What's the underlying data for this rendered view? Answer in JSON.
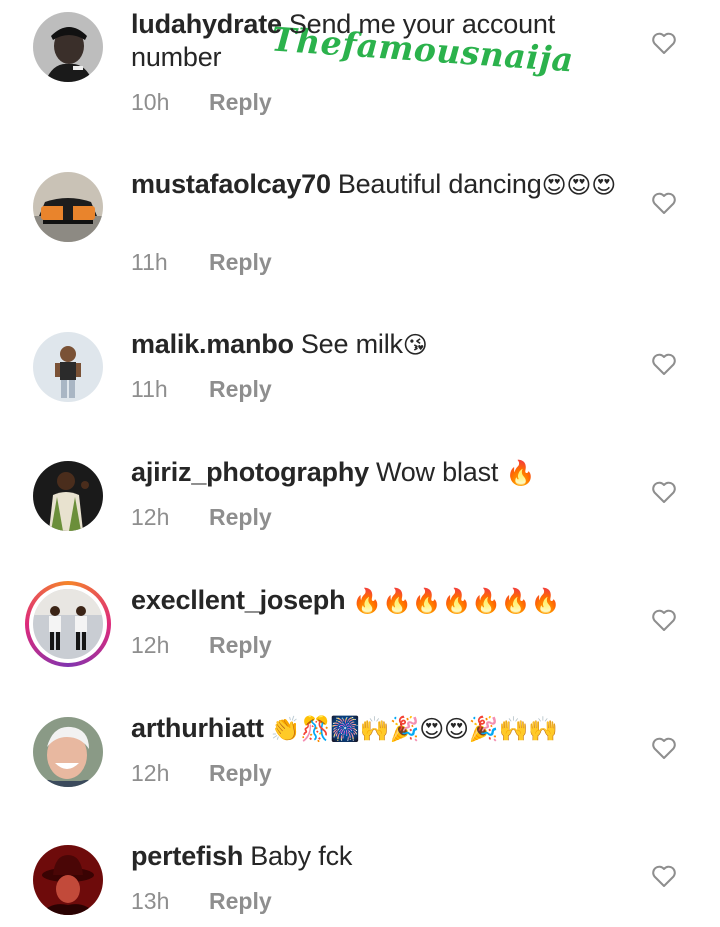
{
  "watermark": "Thefamousnaija",
  "reply_label": "Reply",
  "comments": [
    {
      "username": "ludahydrate",
      "text": "Send me your account number",
      "emoji": "",
      "time": "10h",
      "avatar_icon": "man-in-cap-avatar"
    },
    {
      "username": "mustafaolcay70",
      "text": "Beautiful dancing",
      "emoji": "😍😍😍",
      "time": "11h",
      "avatar_icon": "orange-car-avatar"
    },
    {
      "username": "malik.manbo",
      "text": "See milk",
      "emoji": "😘",
      "time": "11h",
      "avatar_icon": "man-in-shirt-avatar"
    },
    {
      "username": "ajiriz_photography",
      "text": "Wow blast ",
      "emoji": "🔥",
      "time": "12h",
      "avatar_icon": "man-in-vest-avatar"
    },
    {
      "username": "execllent_joseph",
      "text": "",
      "emoji": "🔥🔥🔥🔥🔥🔥🔥",
      "time": "12h",
      "avatar_icon": "two-men-avatar"
    },
    {
      "username": "arthurhiatt",
      "text": "",
      "emoji": "👏🎊🎆🙌🎉😍😍🎉🙌🙌",
      "time": "12h",
      "avatar_icon": "smiling-man-avatar"
    },
    {
      "username": "pertefish",
      "text": "Baby fck",
      "emoji": "",
      "time": "13h",
      "avatar_icon": "red-hat-avatar"
    }
  ],
  "colors": {
    "username": "#262626",
    "meta": "#8e8e8e",
    "watermark": "#2bb24c"
  }
}
